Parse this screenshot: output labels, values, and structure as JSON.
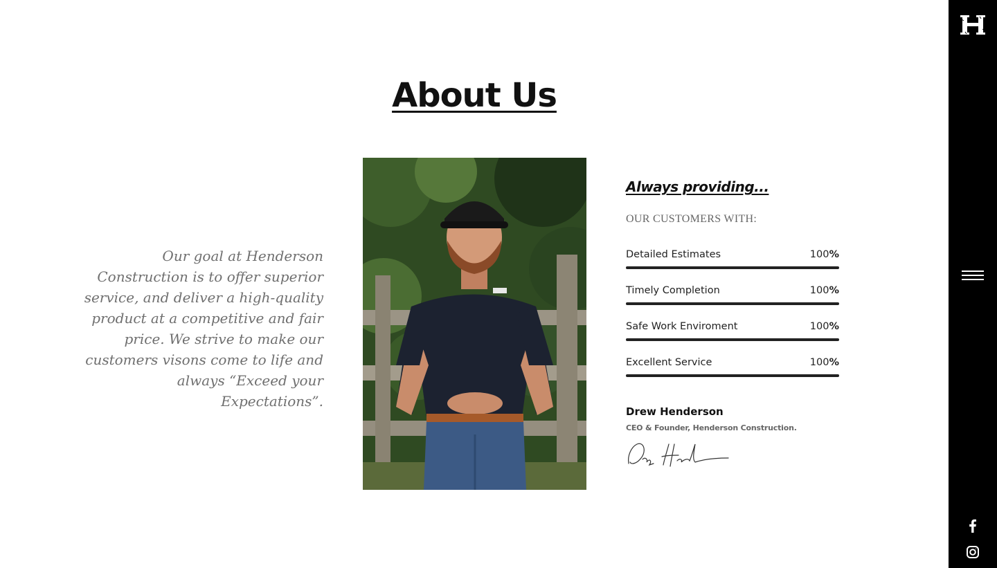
{
  "sidebar": {
    "logo_letter": "H",
    "logo_icon": "henderson-h-logo",
    "menu_icon": "hamburger-menu-icon",
    "social": [
      {
        "name": "facebook-icon"
      },
      {
        "name": "instagram-icon"
      }
    ]
  },
  "page": {
    "title": "About Us"
  },
  "quote": {
    "text": "Our goal at Henderson Construction is to offer superior service, and deliver a high-quality product at a competitive and fair price. We strive to make our customers visons come to life and always “Exceed your Expectations”."
  },
  "photo": {
    "subject": "man-in-navy-polo-and-cap-portrait"
  },
  "providing": {
    "heading": "Always providing...",
    "caption": "OUR CUSTOMERS WITH:",
    "skills": [
      {
        "label": "Detailed Estimates",
        "number": "100",
        "suffix": "%",
        "fill": 1.0
      },
      {
        "label": "Timely Completion",
        "number": "100",
        "suffix": "%",
        "fill": 1.0
      },
      {
        "label": "Safe Work Enviroment",
        "number": "100",
        "suffix": "%",
        "fill": 1.0
      },
      {
        "label": "Excellent Service",
        "number": "100",
        "suffix": "%",
        "fill": 1.0
      }
    ]
  },
  "founder": {
    "name": "Drew Henderson",
    "role": "CEO & Founder, Henderson Construction."
  },
  "colors": {
    "sidebar_bg": "#000000",
    "bar_fill": "#222222",
    "quote_text": "#6f6f6f"
  }
}
